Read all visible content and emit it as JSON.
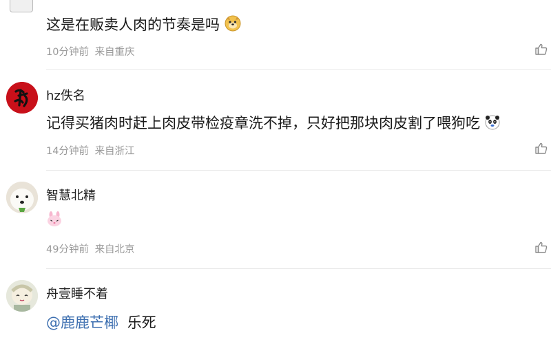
{
  "comments": [
    {
      "user": "",
      "text": "这是在贩卖人肉的节奏是吗",
      "emoji": "doge-emoji",
      "time": "10分钟前",
      "location": "来自重庆"
    },
    {
      "user": "hz佚名",
      "text": "记得买猪肉时赶上肉皮带检疫章洗不掉，只好把那块肉皮割了喂狗吃",
      "emoji": "panda-emoji",
      "time": "14分钟前",
      "location": "来自浙江"
    },
    {
      "user": "智慧北精",
      "text": "",
      "emoji": "pink-bunny-emoji",
      "time": "49分钟前",
      "location": "来自北京"
    },
    {
      "user": "舟壹睡不着",
      "mention": "@鹿鹿芒椰",
      "text": "乐死",
      "time": "",
      "location": ""
    }
  ],
  "icons": {
    "like": "thumbs-up-icon"
  },
  "colors": {
    "mention": "#3d6fb0",
    "meta": "#9a9a9a",
    "divider": "#e8e8e8"
  }
}
